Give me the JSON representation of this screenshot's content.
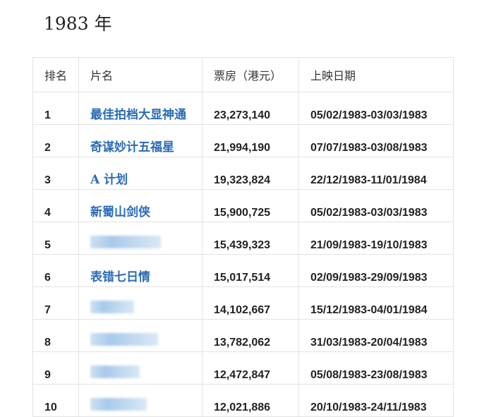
{
  "title": "1983 年",
  "table": {
    "headers": [
      "排名",
      "片名",
      "票房（港元）",
      "上映日期"
    ],
    "rows": [
      {
        "rank": "1",
        "title": "最佳拍档大显神通",
        "box_office": "23,273,140",
        "dates": "05/02/1983-03/03/1983"
      },
      {
        "rank": "2",
        "title": "奇谋妙计五福星",
        "box_office": "21,994,190",
        "dates": "07/07/1983-03/08/1983"
      },
      {
        "rank": "3",
        "title": "A 计划",
        "box_office": "19,323,824",
        "dates": "22/12/1983-11/01/1984"
      },
      {
        "rank": "4",
        "title": "新蜀山剑侠",
        "box_office": "15,900,725",
        "dates": "05/02/1983-03/03/1983"
      },
      {
        "rank": "5",
        "title": null,
        "box_office": "15,439,323",
        "dates": "21/09/1983-19/10/1983"
      },
      {
        "rank": "6",
        "title": "表错七日情",
        "box_office": "15,017,514",
        "dates": "02/09/1983-29/09/1983"
      },
      {
        "rank": "7",
        "title": null,
        "box_office": "14,102,667",
        "dates": "15/12/1983-04/01/1984"
      },
      {
        "rank": "8",
        "title": null,
        "box_office": "13,782,062",
        "dates": "31/03/1983-20/04/1983"
      },
      {
        "rank": "9",
        "title": null,
        "box_office": "12,472,847",
        "dates": "05/08/1983-23/08/1983"
      },
      {
        "rank": "10",
        "title": null,
        "box_office": "12,021,886",
        "dates": "20/10/1983-24/11/1983"
      }
    ]
  },
  "colors": {
    "link": "#2a6bb5",
    "border": "#e3e3e3"
  }
}
